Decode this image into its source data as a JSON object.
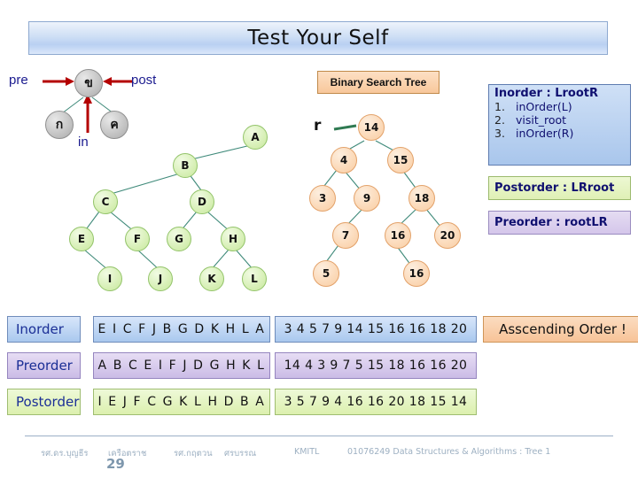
{
  "title": "Test Your Self",
  "mini_diagram": {
    "root": "ข",
    "left": "ก",
    "right": "ค",
    "pre_label": "pre",
    "post_label": "post",
    "in_label": "in"
  },
  "letter_tree": {
    "nodes": [
      "A",
      "B",
      "C",
      "D",
      "E",
      "F",
      "G",
      "H",
      "I",
      "J",
      "K",
      "L"
    ]
  },
  "bst": {
    "badge": "Binary Search Tree",
    "root_pointer": "r",
    "nodes": [
      "14",
      "4",
      "15",
      "3",
      "9",
      "18",
      "7",
      "16",
      "20",
      "5",
      "16"
    ]
  },
  "panels": {
    "inorder": {
      "title": "Inorder : LrootR",
      "steps": [
        {
          "num": "1.",
          "text": "inOrder(L)"
        },
        {
          "num": "2.",
          "text": "visit_root"
        },
        {
          "num": "3.",
          "text": "inOrder(R)"
        }
      ]
    },
    "postorder_title": "Postorder : LRroot",
    "preorder_title": "Preorder : rootLR"
  },
  "table": {
    "rows": [
      {
        "label": "Inorder",
        "letters": "E I C F J B G D K H L A",
        "numbers": "3 4 5 7 9 14 15 16 16 18 20"
      },
      {
        "label": "Preorder",
        "letters": "A B C E I F J D G H K L",
        "numbers": "14 4 3 9 7 5 15 18 16 16 20"
      },
      {
        "label": "Postorder",
        "letters": "I E J F C G K L H D B A",
        "numbers": "3 5 7 9 4 16 16 20 18 15 14"
      }
    ],
    "note": "Asscending Order !"
  },
  "footer": {
    "author1": "รศ.ดร.บุญธีร",
    "author2": "เครือตราช",
    "author3": "รศ.กฤตวน",
    "author4": "ศรบรรณ",
    "institution": "KMITL",
    "course": "01076249 Data Structures & Algorithms : Tree 1",
    "page": "29"
  }
}
